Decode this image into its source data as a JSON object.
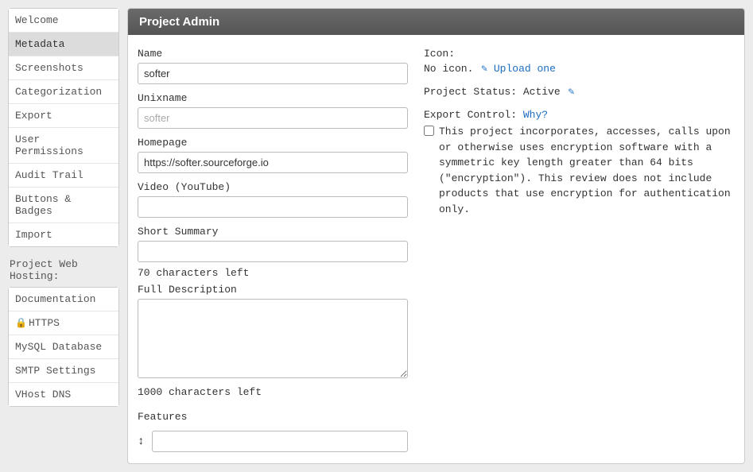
{
  "header": {
    "title": "Project Admin"
  },
  "sidebar": {
    "items": [
      {
        "label": "Welcome"
      },
      {
        "label": "Metadata"
      },
      {
        "label": "Screenshots"
      },
      {
        "label": "Categorization"
      },
      {
        "label": "Export"
      },
      {
        "label": "User Permissions"
      },
      {
        "label": "Audit Trail"
      },
      {
        "label": "Buttons & Badges"
      },
      {
        "label": "Import"
      }
    ],
    "hosting_heading": "Project Web Hosting:",
    "hosting": [
      {
        "label": "Documentation"
      },
      {
        "label": "HTTPS",
        "locked": true
      },
      {
        "label": "MySQL Database"
      },
      {
        "label": "SMTP Settings"
      },
      {
        "label": "VHost DNS"
      }
    ]
  },
  "form": {
    "name_label": "Name",
    "name_value": "softer",
    "unixname_label": "Unixname",
    "unixname_placeholder": "softer",
    "homepage_label": "Homepage",
    "homepage_value": "https://softer.sourceforge.io",
    "video_label": "Video (YouTube)",
    "video_value": "",
    "short_summary_label": "Short Summary",
    "short_summary_value": "",
    "short_summary_chars": "70 characters left",
    "full_desc_label": "Full Description",
    "full_desc_value": "",
    "full_desc_chars": "1000 characters left",
    "features_label": "Features",
    "features_value": ""
  },
  "right": {
    "icon_label": "Icon:",
    "icon_status": "No icon.",
    "upload_label": "Upload one",
    "project_status_label": "Project Status:",
    "project_status_value": "Active",
    "export_control_label": "Export Control:",
    "export_why": "Why?",
    "export_text": "This project incorporates, accesses, calls upon or otherwise uses encryption software with a symmetric key length greater than 64 bits (\"encryption\"). This review does not include products that use encryption for authentication only."
  }
}
